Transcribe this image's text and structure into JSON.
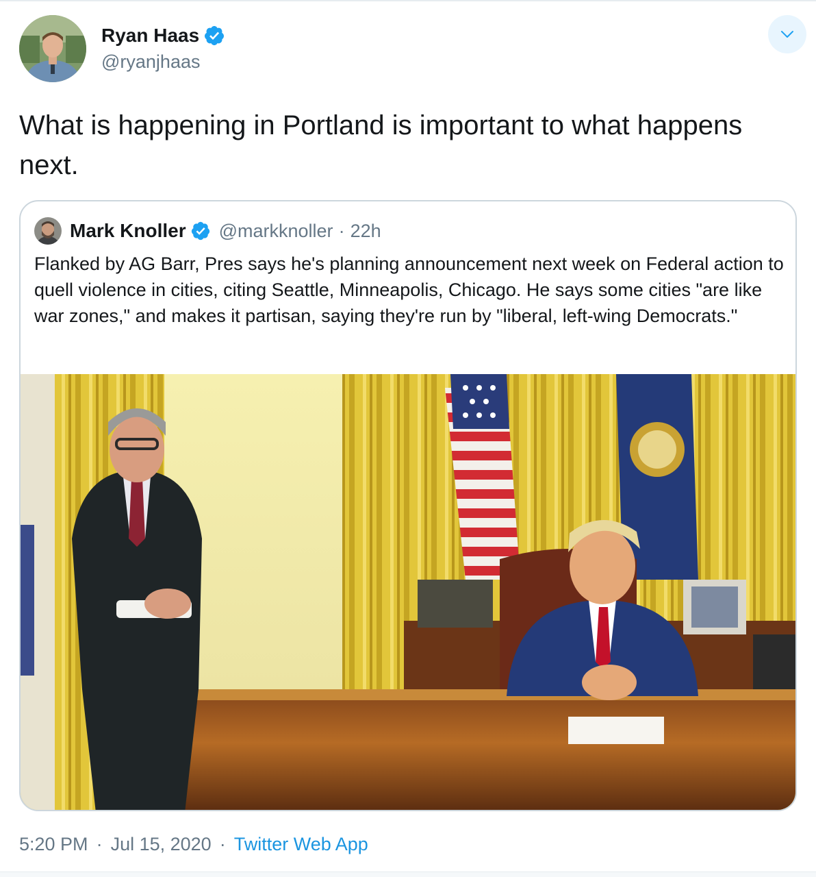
{
  "author": {
    "display_name": "Ryan Haas",
    "handle": "@ryanjhaas",
    "verified": true,
    "avatar_icon": "user-avatar"
  },
  "tweet": {
    "text": "What is happening in Portland is important to what happens next."
  },
  "quoted_tweet": {
    "display_name": "Mark Knoller",
    "handle": "@markknoller",
    "separator": "·",
    "time": "22h",
    "verified": true,
    "text": "Flanked by AG Barr, Pres says he's planning announcement next week on Federal action to quell violence in cities, citing Seattle, Minneapolis, Chicago. He says some cities \"are like war zones,\" and makes it partisan, saying they're run by \"liberal, left-wing Democrats.\""
  },
  "footer": {
    "time": "5:20 PM",
    "separator": "·",
    "date": "Jul 15, 2020",
    "source": "Twitter Web App"
  },
  "colors": {
    "brand_blue": "#1da1f2",
    "link_blue": "#1b95e0",
    "secondary_text": "#657786",
    "border": "#ccd6dd"
  }
}
